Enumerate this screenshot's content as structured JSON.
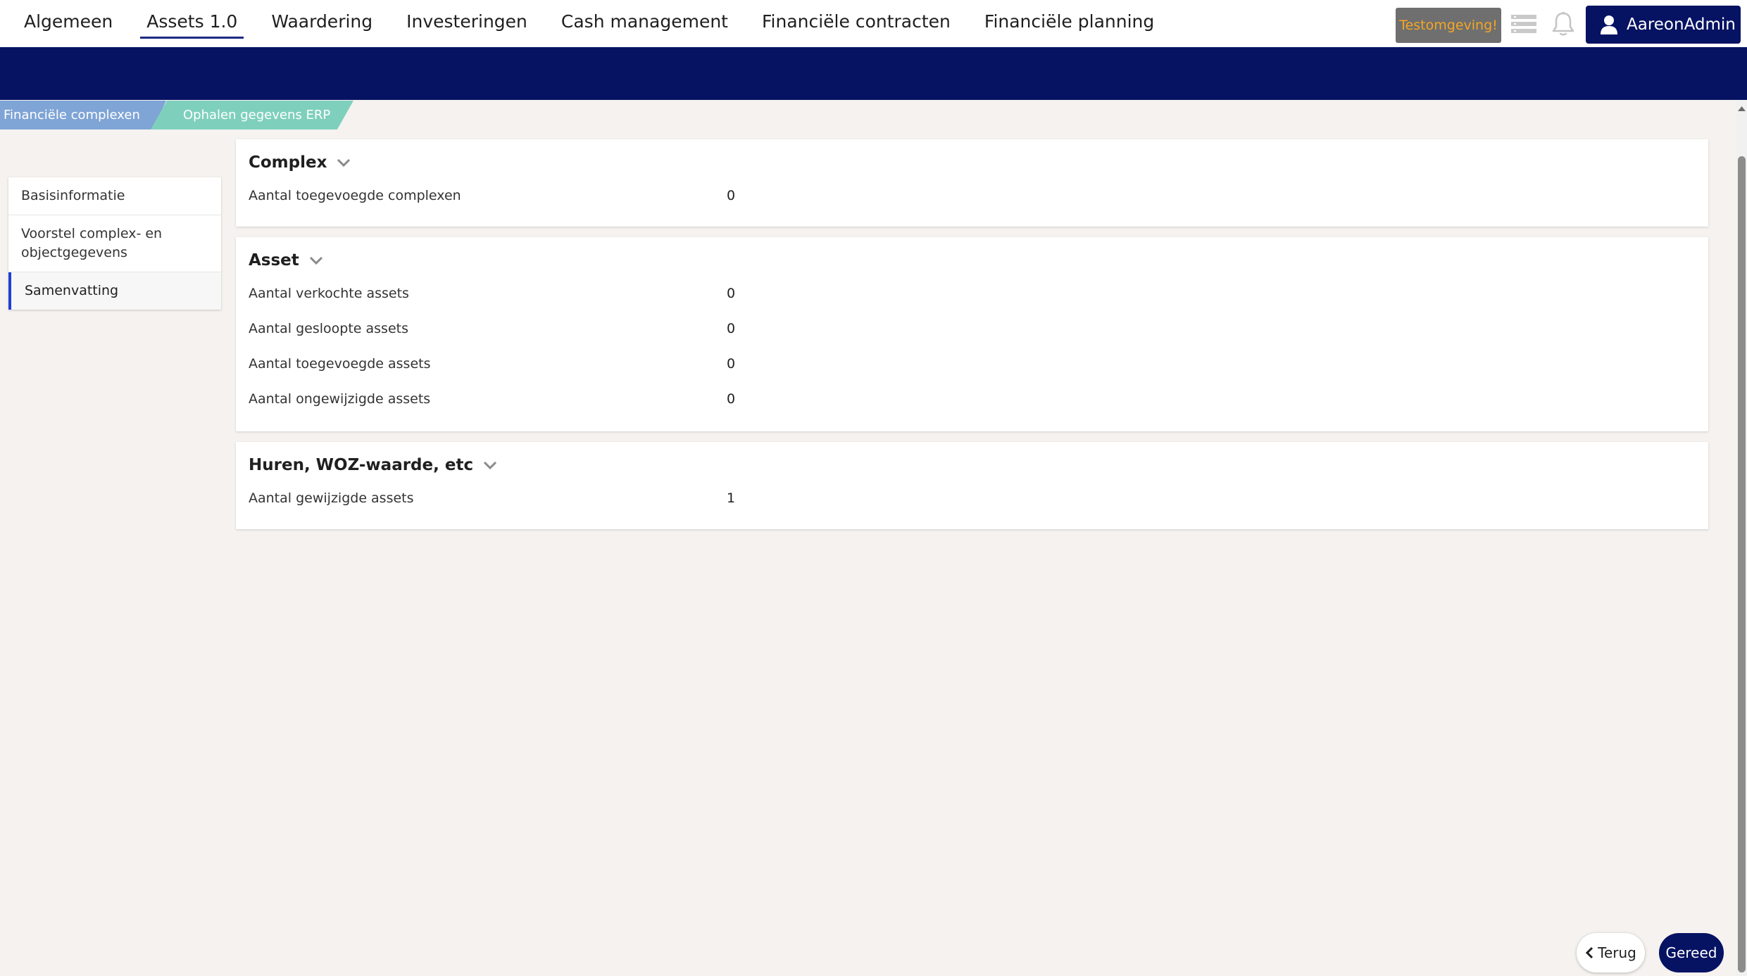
{
  "nav": {
    "items": [
      {
        "label": "Algemeen"
      },
      {
        "label": "Assets 1.0",
        "active": true
      },
      {
        "label": "Waardering"
      },
      {
        "label": "Investeringen"
      },
      {
        "label": "Cash management"
      },
      {
        "label": "Financiële contracten"
      },
      {
        "label": "Financiële planning"
      }
    ],
    "test_badge": "Testomgeving!",
    "menu_icon": "list-menu-icon",
    "bell_icon": "bell-icon",
    "user_icon": "user-icon",
    "user_name": "AareonAdmin"
  },
  "breadcrumb": {
    "first": "Financiële complexen",
    "second": "Ophalen gegevens ERP"
  },
  "steps": [
    {
      "label": "Basisinformatie"
    },
    {
      "label": "Voorstel complex- en objectgegevens"
    },
    {
      "label": "Samenvatting",
      "active": true
    }
  ],
  "cards": {
    "complex": {
      "title": "Complex",
      "rows": [
        {
          "label": "Aantal toegevoegde complexen",
          "value": "0"
        }
      ]
    },
    "asset": {
      "title": "Asset",
      "rows": [
        {
          "label": "Aantal verkochte assets",
          "value": "0"
        },
        {
          "label": "Aantal gesloopte assets",
          "value": "0"
        },
        {
          "label": "Aantal toegevoegde assets",
          "value": "0"
        },
        {
          "label": "Aantal ongewijzigde assets",
          "value": "0"
        }
      ]
    },
    "huren": {
      "title": "Huren, WOZ-waarde, etc",
      "rows": [
        {
          "label": "Aantal gewijzigde assets",
          "value": "1"
        }
      ]
    }
  },
  "footer": {
    "back_label": "Terug",
    "done_label": "Gereed"
  },
  "colors": {
    "primary": "#061262",
    "breadcrumb_first": "#7fa4d6",
    "breadcrumb_second": "#7ed0bd",
    "test_badge_text": "#f5a623",
    "active_step": "#1e3fd6",
    "background": "#f5f2ef"
  }
}
